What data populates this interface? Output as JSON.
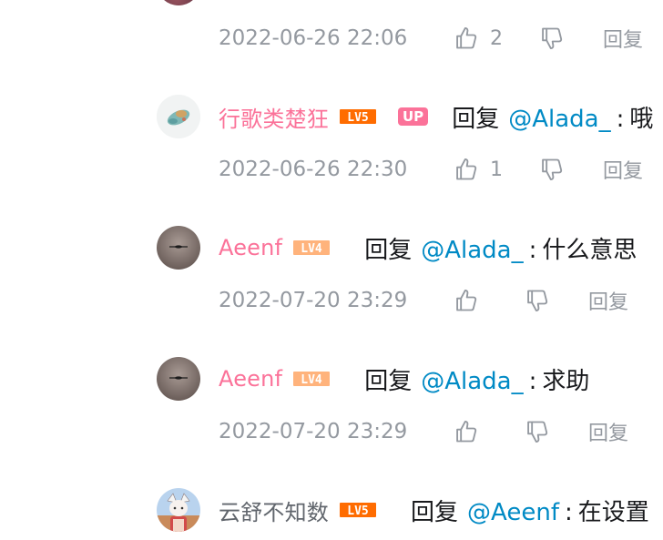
{
  "top_meta": {
    "time": "2022-06-26 22:06",
    "like_count": "2",
    "reply_label": "回复"
  },
  "replies": [
    {
      "username": "行歌类楚狂",
      "level": "LV5",
      "up_label": "UP",
      "reply_word": "回复",
      "at_user": "@Alada_",
      "colon": ":",
      "text": "哦",
      "time": "2022-06-26 22:30",
      "like_count": "1",
      "reply_label": "回复"
    },
    {
      "username": "Aeenf",
      "level": "LV4",
      "reply_word": "回复",
      "at_user": "@Alada_",
      "colon": ":",
      "text": "什么意思",
      "time": "2022-07-20 23:29",
      "like_count": "",
      "reply_label": "回复"
    },
    {
      "username": "Aeenf",
      "level": "LV4",
      "reply_word": "回复",
      "at_user": "@Alada_",
      "colon": ":",
      "text": "求助",
      "time": "2022-07-20 23:29",
      "like_count": "",
      "reply_label": "回复"
    },
    {
      "username": "云舒不知数",
      "level": "LV5",
      "reply_word": "回复",
      "at_user": "@Aeenf",
      "colon": ":",
      "text": "在设置",
      "time": "",
      "like_count": "",
      "reply_label": ""
    }
  ],
  "colors": {
    "username_pink": "#fb7299",
    "username_gray": "#61666d",
    "mention_blue": "#008ac5",
    "meta_gray": "#9499a0",
    "lv5_orange": "#ff6c00",
    "lv4_peach": "#ffb37c"
  }
}
